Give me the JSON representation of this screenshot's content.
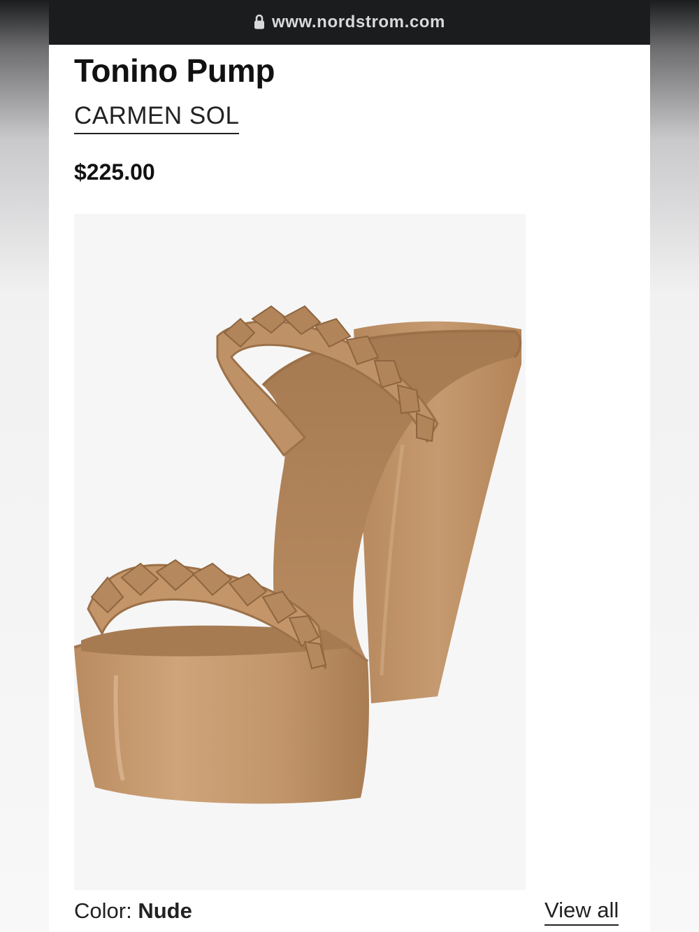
{
  "browser": {
    "url": "www.nordstrom.com",
    "icon": "lock-icon"
  },
  "product": {
    "title": "Tonino Pump",
    "brand": "CARMEN SOL",
    "price": "$225.00",
    "image_alt": "nude jelly wedge slide sandal with studded straps",
    "color_label": "Color:",
    "color_value": "Nude",
    "view_all": "View all"
  },
  "colors": {
    "browser_bar": "#1b1c1e",
    "shoe": "#c0936a",
    "image_bg": "#f6f6f6"
  }
}
